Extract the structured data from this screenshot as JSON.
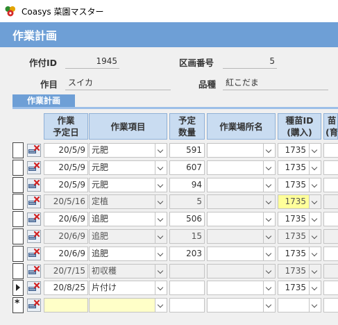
{
  "window": {
    "title": "Coasys 菜園マスター"
  },
  "form": {
    "title": "作業計画"
  },
  "fields": {
    "sakutsuke_id": {
      "label": "作付ID",
      "value": "1945"
    },
    "kukaku_bango": {
      "label": "区画番号",
      "value": "5"
    },
    "sakumotsu": {
      "label": "作目",
      "value": "スイカ"
    },
    "hinshu": {
      "label": "品種",
      "value": "紅こだま"
    }
  },
  "subform": {
    "title": "作業計画",
    "columns": {
      "date_l1": "作業",
      "date_l2": "予定日",
      "item": "作業項目",
      "qty_l1": "予定",
      "qty_l2": "数量",
      "place": "作業場所名",
      "seed_l1": "種苗ID",
      "seed_l2": "(購入)",
      "extra_l1": "苗",
      "extra_l2": "(育"
    },
    "rows": [
      {
        "date": "20/5/9",
        "item": "元肥",
        "qty": "591",
        "seed": "1735"
      },
      {
        "date": "20/5/9",
        "item": "元肥",
        "qty": "607",
        "seed": "1735"
      },
      {
        "date": "20/5/9",
        "item": "元肥",
        "qty": "94",
        "seed": "1735"
      },
      {
        "date": "20/5/16",
        "item": "定植",
        "qty": "5",
        "seed": "1735"
      },
      {
        "date": "20/6/9",
        "item": "追肥",
        "qty": "506",
        "seed": "1735"
      },
      {
        "date": "20/6/9",
        "item": "追肥",
        "qty": "15",
        "seed": "1735"
      },
      {
        "date": "20/6/9",
        "item": "追肥",
        "qty": "203",
        "seed": "1735"
      },
      {
        "date": "20/7/15",
        "item": "初収穫",
        "qty": "",
        "seed": "1735"
      },
      {
        "date": "20/8/25",
        "item": "片付け",
        "qty": "",
        "seed": "1735"
      },
      {
        "date": "",
        "item": "",
        "qty": "",
        "seed": ""
      }
    ],
    "current_row_marker": "▶",
    "new_row_marker": "*"
  },
  "colors": {
    "header_blue": "#6e9fd6",
    "column_header": "#c9dcf1",
    "highlight": "#ffff9a",
    "new_row": "#ffffc8"
  }
}
